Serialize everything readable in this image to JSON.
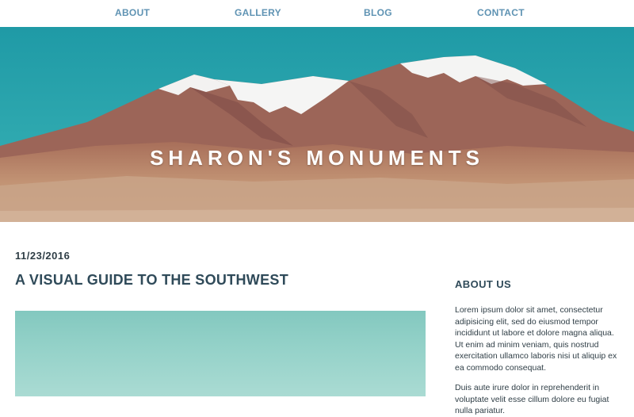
{
  "nav": {
    "about": "ABOUT",
    "gallery": "GALLERY",
    "blog": "BLOG",
    "contact": "CONTACT"
  },
  "hero": {
    "title": "SHARON'S MONUMENTS"
  },
  "post": {
    "date": "11/23/2016",
    "title": "A VISUAL GUIDE TO THE SOUTHWEST"
  },
  "sidebar": {
    "title": "ABOUT US",
    "paragraph1": "Lorem ipsum dolor sit amet, consectetur adipisicing elit, sed do eiusmod tempor incididunt ut labore et dolore magna aliqua. Ut enim ad minim veniam, quis nostrud exercitation ullamco laboris nisi ut aliquip ex ea commodo consequat.",
    "paragraph2": "Duis aute irure dolor in reprehenderit in voluptate velit esse cillum dolore eu fugiat nulla pariatur."
  },
  "colors": {
    "nav_link": "#5f93b3",
    "heading": "#2f4a59",
    "sky": "#27a3ad",
    "desert": "#b98a6c"
  }
}
